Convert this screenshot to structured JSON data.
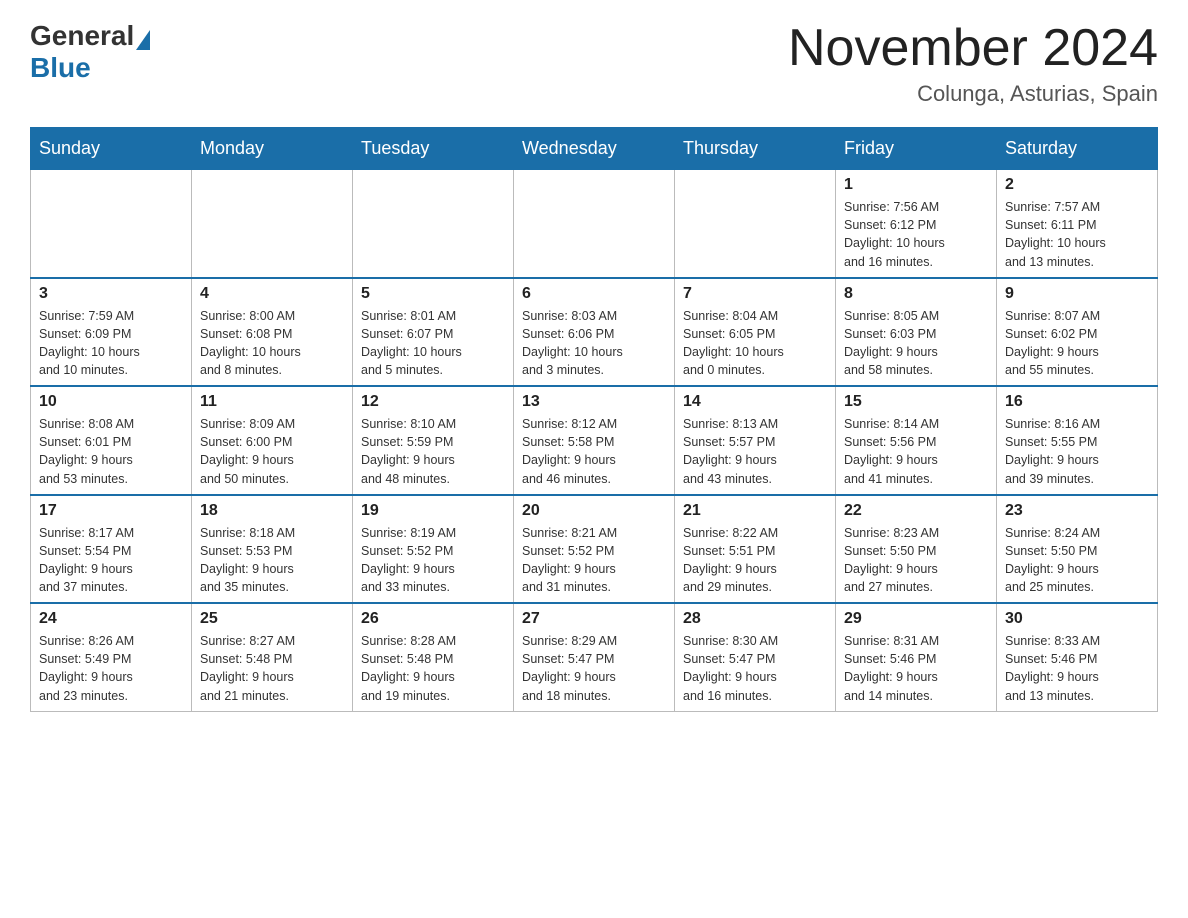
{
  "header": {
    "logo_text_general": "General",
    "logo_text_blue": "Blue",
    "title": "November 2024",
    "location": "Colunga, Asturias, Spain"
  },
  "weekdays": [
    "Sunday",
    "Monday",
    "Tuesday",
    "Wednesday",
    "Thursday",
    "Friday",
    "Saturday"
  ],
  "weeks": [
    [
      {
        "day": "",
        "info": ""
      },
      {
        "day": "",
        "info": ""
      },
      {
        "day": "",
        "info": ""
      },
      {
        "day": "",
        "info": ""
      },
      {
        "day": "",
        "info": ""
      },
      {
        "day": "1",
        "info": "Sunrise: 7:56 AM\nSunset: 6:12 PM\nDaylight: 10 hours\nand 16 minutes."
      },
      {
        "day": "2",
        "info": "Sunrise: 7:57 AM\nSunset: 6:11 PM\nDaylight: 10 hours\nand 13 minutes."
      }
    ],
    [
      {
        "day": "3",
        "info": "Sunrise: 7:59 AM\nSunset: 6:09 PM\nDaylight: 10 hours\nand 10 minutes."
      },
      {
        "day": "4",
        "info": "Sunrise: 8:00 AM\nSunset: 6:08 PM\nDaylight: 10 hours\nand 8 minutes."
      },
      {
        "day": "5",
        "info": "Sunrise: 8:01 AM\nSunset: 6:07 PM\nDaylight: 10 hours\nand 5 minutes."
      },
      {
        "day": "6",
        "info": "Sunrise: 8:03 AM\nSunset: 6:06 PM\nDaylight: 10 hours\nand 3 minutes."
      },
      {
        "day": "7",
        "info": "Sunrise: 8:04 AM\nSunset: 6:05 PM\nDaylight: 10 hours\nand 0 minutes."
      },
      {
        "day": "8",
        "info": "Sunrise: 8:05 AM\nSunset: 6:03 PM\nDaylight: 9 hours\nand 58 minutes."
      },
      {
        "day": "9",
        "info": "Sunrise: 8:07 AM\nSunset: 6:02 PM\nDaylight: 9 hours\nand 55 minutes."
      }
    ],
    [
      {
        "day": "10",
        "info": "Sunrise: 8:08 AM\nSunset: 6:01 PM\nDaylight: 9 hours\nand 53 minutes."
      },
      {
        "day": "11",
        "info": "Sunrise: 8:09 AM\nSunset: 6:00 PM\nDaylight: 9 hours\nand 50 minutes."
      },
      {
        "day": "12",
        "info": "Sunrise: 8:10 AM\nSunset: 5:59 PM\nDaylight: 9 hours\nand 48 minutes."
      },
      {
        "day": "13",
        "info": "Sunrise: 8:12 AM\nSunset: 5:58 PM\nDaylight: 9 hours\nand 46 minutes."
      },
      {
        "day": "14",
        "info": "Sunrise: 8:13 AM\nSunset: 5:57 PM\nDaylight: 9 hours\nand 43 minutes."
      },
      {
        "day": "15",
        "info": "Sunrise: 8:14 AM\nSunset: 5:56 PM\nDaylight: 9 hours\nand 41 minutes."
      },
      {
        "day": "16",
        "info": "Sunrise: 8:16 AM\nSunset: 5:55 PM\nDaylight: 9 hours\nand 39 minutes."
      }
    ],
    [
      {
        "day": "17",
        "info": "Sunrise: 8:17 AM\nSunset: 5:54 PM\nDaylight: 9 hours\nand 37 minutes."
      },
      {
        "day": "18",
        "info": "Sunrise: 8:18 AM\nSunset: 5:53 PM\nDaylight: 9 hours\nand 35 minutes."
      },
      {
        "day": "19",
        "info": "Sunrise: 8:19 AM\nSunset: 5:52 PM\nDaylight: 9 hours\nand 33 minutes."
      },
      {
        "day": "20",
        "info": "Sunrise: 8:21 AM\nSunset: 5:52 PM\nDaylight: 9 hours\nand 31 minutes."
      },
      {
        "day": "21",
        "info": "Sunrise: 8:22 AM\nSunset: 5:51 PM\nDaylight: 9 hours\nand 29 minutes."
      },
      {
        "day": "22",
        "info": "Sunrise: 8:23 AM\nSunset: 5:50 PM\nDaylight: 9 hours\nand 27 minutes."
      },
      {
        "day": "23",
        "info": "Sunrise: 8:24 AM\nSunset: 5:50 PM\nDaylight: 9 hours\nand 25 minutes."
      }
    ],
    [
      {
        "day": "24",
        "info": "Sunrise: 8:26 AM\nSunset: 5:49 PM\nDaylight: 9 hours\nand 23 minutes."
      },
      {
        "day": "25",
        "info": "Sunrise: 8:27 AM\nSunset: 5:48 PM\nDaylight: 9 hours\nand 21 minutes."
      },
      {
        "day": "26",
        "info": "Sunrise: 8:28 AM\nSunset: 5:48 PM\nDaylight: 9 hours\nand 19 minutes."
      },
      {
        "day": "27",
        "info": "Sunrise: 8:29 AM\nSunset: 5:47 PM\nDaylight: 9 hours\nand 18 minutes."
      },
      {
        "day": "28",
        "info": "Sunrise: 8:30 AM\nSunset: 5:47 PM\nDaylight: 9 hours\nand 16 minutes."
      },
      {
        "day": "29",
        "info": "Sunrise: 8:31 AM\nSunset: 5:46 PM\nDaylight: 9 hours\nand 14 minutes."
      },
      {
        "day": "30",
        "info": "Sunrise: 8:33 AM\nSunset: 5:46 PM\nDaylight: 9 hours\nand 13 minutes."
      }
    ]
  ]
}
